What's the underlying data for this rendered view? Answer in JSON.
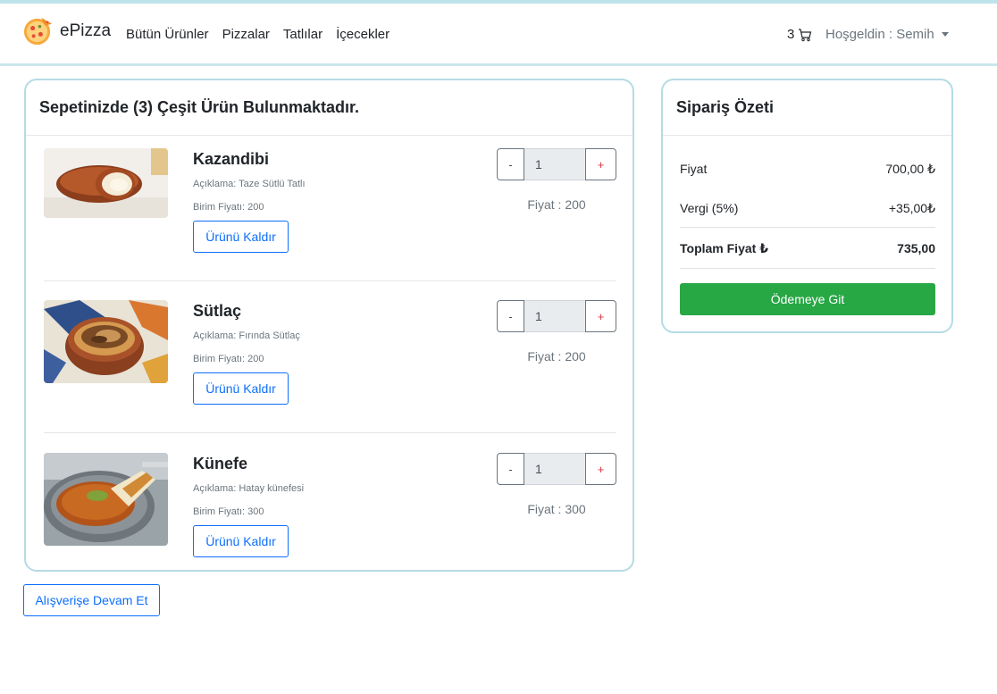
{
  "navbar": {
    "brand": "ePizza",
    "links": [
      "Bütün Ürünler",
      "Pizzalar",
      "Tatlılar",
      "İçecekler"
    ],
    "cart_count": "3",
    "user_label": "Hoşgeldin : Semih"
  },
  "cart": {
    "header": "Sepetinizde (3) Çeşit Ürün Bulunmaktadır.",
    "items": [
      {
        "name": "Kazandibi",
        "description": "Açıklama: Taze Sütlü Tatlı",
        "unit_price": "Birim Fiyatı: 200",
        "remove_label": "Ürünü Kaldır",
        "quantity": "1",
        "total": "Fiyat : 200",
        "minus": "-",
        "plus": "+"
      },
      {
        "name": "Sütlaç",
        "description": "Açıklama: Fırında Sütlaç",
        "unit_price": "Birim Fiyatı: 200",
        "remove_label": "Ürünü Kaldır",
        "quantity": "1",
        "total": "Fiyat : 200",
        "minus": "-",
        "plus": "+"
      },
      {
        "name": "Künefe",
        "description": "Açıklama: Hatay künefesi",
        "unit_price": "Birim Fiyatı: 300",
        "remove_label": "Ürünü Kaldır",
        "quantity": "1",
        "total": "Fiyat : 300",
        "minus": "-",
        "plus": "+"
      }
    ]
  },
  "summary": {
    "header": "Sipariş Özeti",
    "price_label": "Fiyat",
    "price_value": "700,00 ₺",
    "tax_label": "Vergi (5%)",
    "tax_value": "+35,00₺",
    "total_label": "Toplam Fiyat ₺",
    "total_value": "735,00",
    "checkout_label": "Ödemeye Git"
  },
  "continue_label": "Alışverişe Devam Et",
  "colors": {
    "primary": "#0d6efd",
    "success": "#28a745",
    "card_border": "#b5dbe5"
  }
}
